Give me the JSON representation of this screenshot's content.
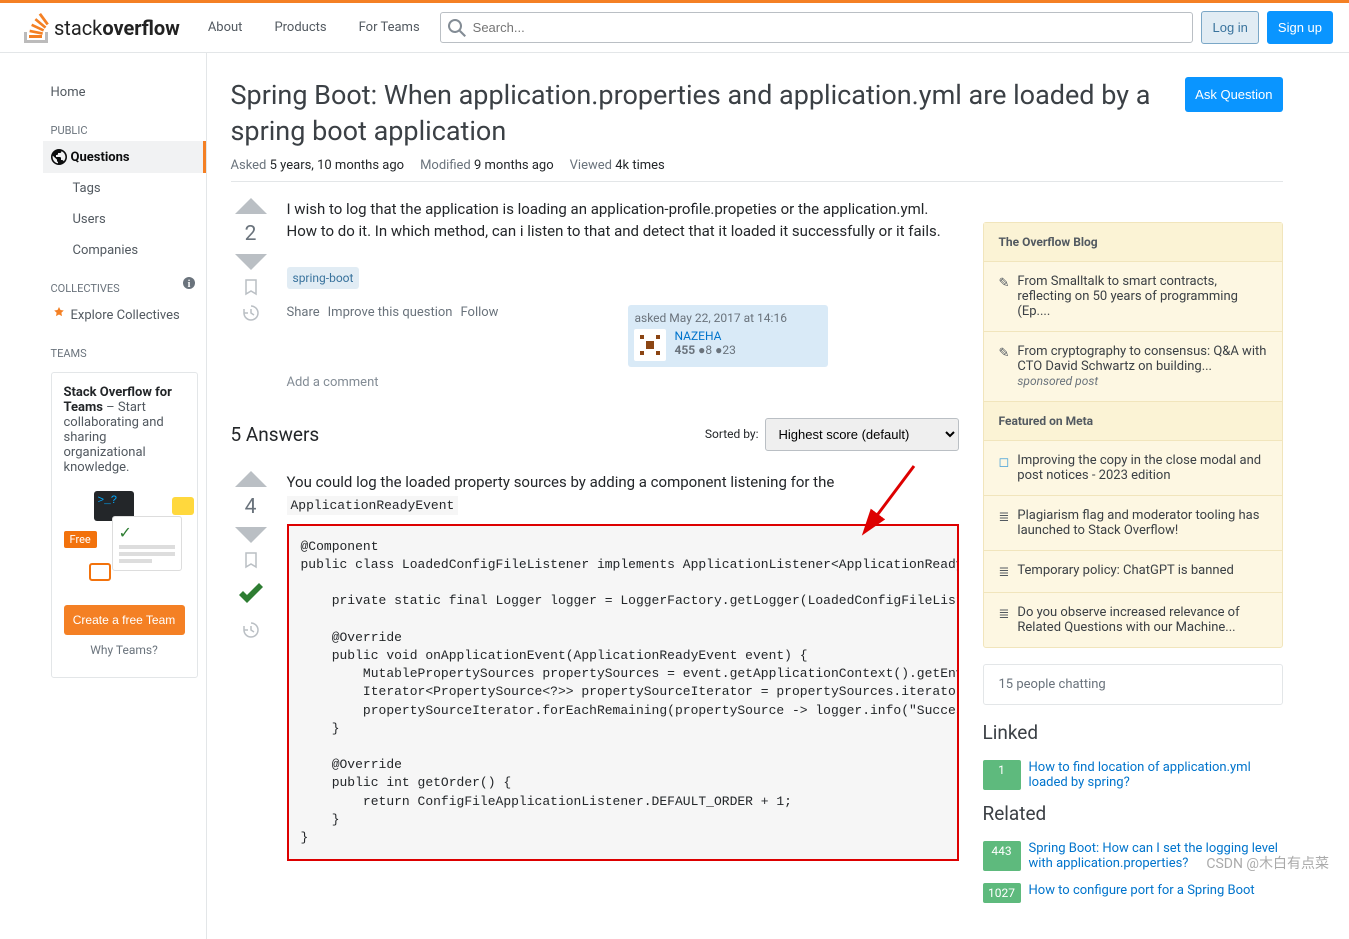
{
  "header": {
    "nav": {
      "about": "About",
      "products": "Products",
      "teams": "For Teams"
    },
    "search_placeholder": "Search...",
    "login": "Log in",
    "signup": "Sign up"
  },
  "sidebar": {
    "home": "Home",
    "public": "PUBLIC",
    "questions": "Questions",
    "tags": "Tags",
    "users": "Users",
    "companies": "Companies",
    "collectives": "COLLECTIVES",
    "explore": "Explore Collectives",
    "teams": "TEAMS",
    "teams_box_title": "Stack Overflow for Teams",
    "teams_box_text": " – Start collaborating and sharing organizational knowledge.",
    "free_badge": "Free",
    "create_team": "Create a free Team",
    "why_teams": "Why Teams?"
  },
  "question": {
    "title": "Spring Boot: When application.properties and application.yml are loaded by a spring boot application",
    "ask_button": "Ask Question",
    "asked_label": "Asked",
    "asked_value": "5 years, 10 months ago",
    "modified_label": "Modified",
    "modified_value": "9 months ago",
    "viewed_label": "Viewed",
    "viewed_value": "4k times",
    "vote_count": "2",
    "body": "I wish to log that the application is loading an application-profile.propeties or the application.yml. How to do it. In which method, can i listen to that and detect that it loaded it successfully or it fails.",
    "tag": "spring-boot",
    "actions": {
      "share": "Share",
      "improve": "Improve this question",
      "follow": "Follow"
    },
    "user": {
      "time": "asked May 22, 2017 at 14:16",
      "name": "NAZEHA",
      "rep": "455",
      "silver": "8",
      "bronze": "23"
    },
    "add_comment": "Add a comment"
  },
  "answers": {
    "count": "5 Answers",
    "sorted_by": "Sorted by:",
    "sort_value": "Highest score (default)",
    "a1": {
      "vote": "4",
      "intro": "You could log the loaded property sources by adding a component listening for the ",
      "intro_code": "ApplicationReadyEvent",
      "code": "@Component\npublic class LoadedConfigFileListener implements ApplicationListener<ApplicationReadyEvent>\n\n    private static final Logger logger = LoggerFactory.getLogger(LoadedConfigFileListener.c\n\n    @Override\n    public void onApplicationEvent(ApplicationReadyEvent event) {\n        MutablePropertySources propertySources = event.getApplicationContext().getEnvironme\n        Iterator<PropertySource<?>> propertySourceIterator = propertySources.iterator();\n        propertySourceIterator.forEachRemaining(propertySource -> logger.info(\"Successfully\n    }\n\n    @Override\n    public int getOrder() {\n        return ConfigFileApplicationListener.DEFAULT_ORDER + 1;\n    }\n}"
    }
  },
  "right": {
    "blog": "The Overflow Blog",
    "blog1": "From Smalltalk to smart contracts, reflecting on 50 years of programming (Ep....",
    "blog2": "From cryptography to consensus: Q&A with CTO David Schwartz on building...",
    "sponsored": "sponsored post",
    "meta": "Featured on Meta",
    "meta1": "Improving the copy in the close modal and post notices - 2023 edition",
    "meta2": "Plagiarism flag and moderator tooling has launched to Stack Overflow!",
    "meta3": "Temporary policy: ChatGPT is banned",
    "meta4": "Do you observe increased relevance of Related Questions with our Machine...",
    "chat": "15 people chatting",
    "linked": "Linked",
    "linked1": {
      "score": "1",
      "title": "How to find location of application.yml loaded by spring?"
    },
    "related": "Related",
    "related1": {
      "score": "443",
      "title": "Spring Boot: How can I set the logging level with application.properties?"
    },
    "related2": {
      "score": "1027",
      "title": "How to configure port for a Spring Boot"
    }
  },
  "watermark": "CSDN @木白有点菜"
}
